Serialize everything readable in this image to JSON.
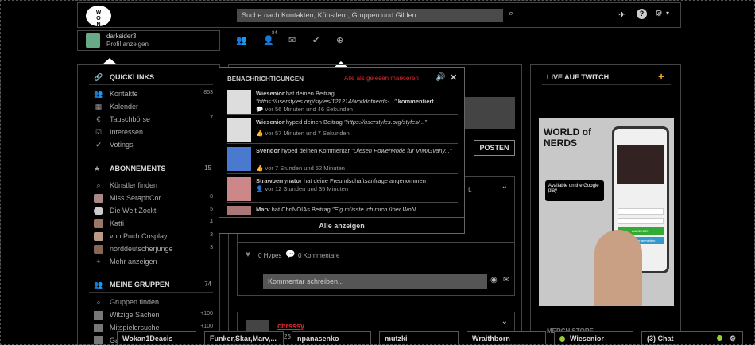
{
  "topbar": {
    "logo": "WORLD of NERDS",
    "search_placeholder": "Suche nach Kontakten, Künstlern, Gruppen und Gilden ..."
  },
  "profile": {
    "name": "darksider3",
    "link": "Profil anzeigen"
  },
  "nav": {
    "friend_count": "84"
  },
  "sidebar": {
    "quicklinks": {
      "title": "QUICKLINKS",
      "items": [
        {
          "label": "Kontakte",
          "count": "853"
        },
        {
          "label": "Kalender",
          "count": ""
        },
        {
          "label": "Tauschbörse",
          "count": "7"
        },
        {
          "label": "Interessen",
          "count": ""
        },
        {
          "label": "Votings",
          "count": ""
        }
      ]
    },
    "abos": {
      "title": "ABONNEMENTS",
      "count": "15",
      "items": [
        {
          "label": "Künstler finden",
          "count": ""
        },
        {
          "label": "Miss SeraphCor",
          "count": "8"
        },
        {
          "label": "Die Welt Zockt",
          "count": "5"
        },
        {
          "label": "Katti",
          "count": "4"
        },
        {
          "label": "von Puch Cosplay",
          "count": "3"
        },
        {
          "label": "norddeutscherjunge",
          "count": "3"
        },
        {
          "label": "Mehr anzeigen",
          "count": ""
        }
      ]
    },
    "groups": {
      "title": "MEINE GRUPPEN",
      "count": "74",
      "items": [
        {
          "label": "Gruppen finden",
          "count": ""
        },
        {
          "label": "Witzige Sachen",
          "count": "+100"
        },
        {
          "label": "Mitspielersuche",
          "count": "+100"
        },
        {
          "label": "Ga",
          "count": ""
        }
      ]
    }
  },
  "center": {
    "post_button": "POSTEN",
    "hypes": "0 Hypes",
    "comments": "0 Kommentare",
    "comment_placeholder": "Kommentar schreiben...",
    "second_user": "chrsssy",
    "partial_text": "t:",
    "partial_num": "25"
  },
  "notifications": {
    "title": "BENACHRICHTIGUNGEN",
    "mark_all": "Alle als gelesen markieren",
    "show_all": "Alle anzeigen",
    "items": [
      {
        "user": "Wiesenior",
        "action": "hat deinen Beitrag",
        "quote": "\"https://userstyles.org/styles/121214/worldofnerds-...\"",
        "suffix": "kommentiert.",
        "time": "vor 56 Minuten und 46 Sekunden"
      },
      {
        "user": "Wiesenior",
        "action": "hyped deinen Beitrag",
        "quote": "\"https://userstyles.org/styles/...\"",
        "suffix": "",
        "time": "vor 57 Minuten und 7 Sekunden"
      },
      {
        "user": "Svendor",
        "action": "hyped deinen Kommentar",
        "quote": "\"Diesen PowerMode für VIM/Gvany...\"",
        "suffix": "",
        "time": "vor 7 Stunden und 52 Minuten"
      },
      {
        "user": "Strawberrynator",
        "action": "hat deine Freundschaftsanfrage angenommen",
        "quote": "",
        "suffix": "",
        "time": "vor 12 Stunden und 35 Minuten"
      },
      {
        "user": "Marv",
        "action": "hat ChriNOIAs Beitrag",
        "quote": "\"Eig müsste ich mich über WoN",
        "suffix": "",
        "time": ""
      }
    ]
  },
  "right": {
    "title": "LIVE AUF TWITCH",
    "ad_logo": "WORLD of NERDS",
    "ad_store": "Available on the Google play",
    "ad_buttons": [
      "ANMELDEN",
      "Mit Twitter anmelden"
    ],
    "bottom_label": "MERCH STORE"
  },
  "chats": [
    {
      "label": "Wokan1Deacis"
    },
    {
      "label": "Funker,Skar,Marv,..."
    },
    {
      "label": "npanasenko"
    },
    {
      "label": "mutzki"
    },
    {
      "label": "Wraithborn"
    },
    {
      "label": "Wiesenior"
    },
    {
      "label": "(3) Chat"
    }
  ],
  "colors": {
    "accent_red": "#e0282c",
    "accent_orange": "#f5a623",
    "online": "#99cc33"
  }
}
